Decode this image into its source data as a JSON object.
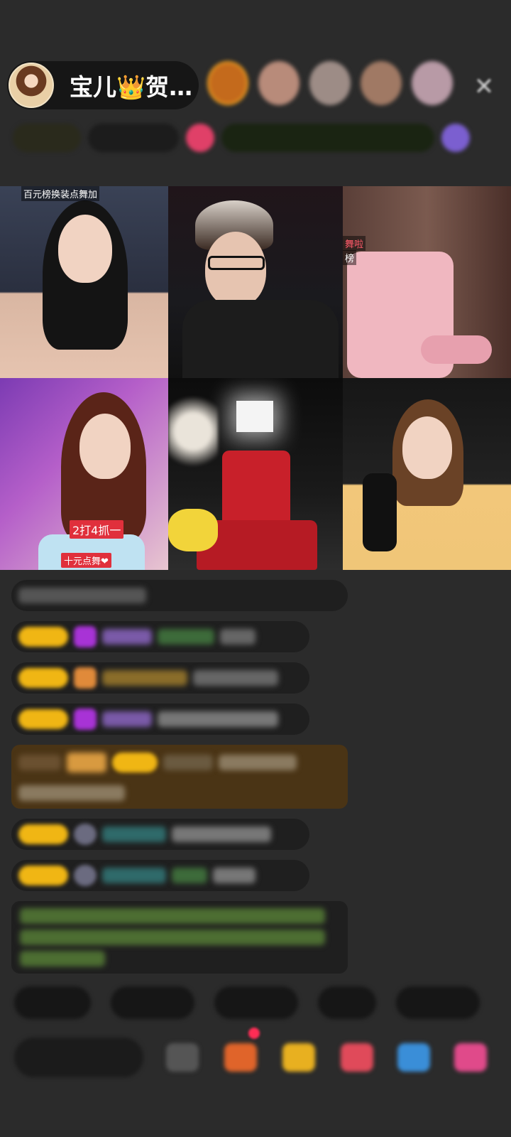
{
  "host": {
    "name": "宝儿👑贺…"
  },
  "viewers": {
    "colors": [
      "#c46a1c",
      "#b88b7a",
      "#9d8c86",
      "#a07964",
      "#b89aa6"
    ]
  },
  "tiles": [
    {
      "caption": "百元榜换装点舞加"
    },
    {},
    {
      "caption_top": "舞啦",
      "caption_bottom": "榜"
    },
    {
      "badge": "2打4抓一",
      "caption": "十元点舞❤"
    },
    {},
    {}
  ],
  "toolbar": {
    "close_icon": "close-icon"
  }
}
